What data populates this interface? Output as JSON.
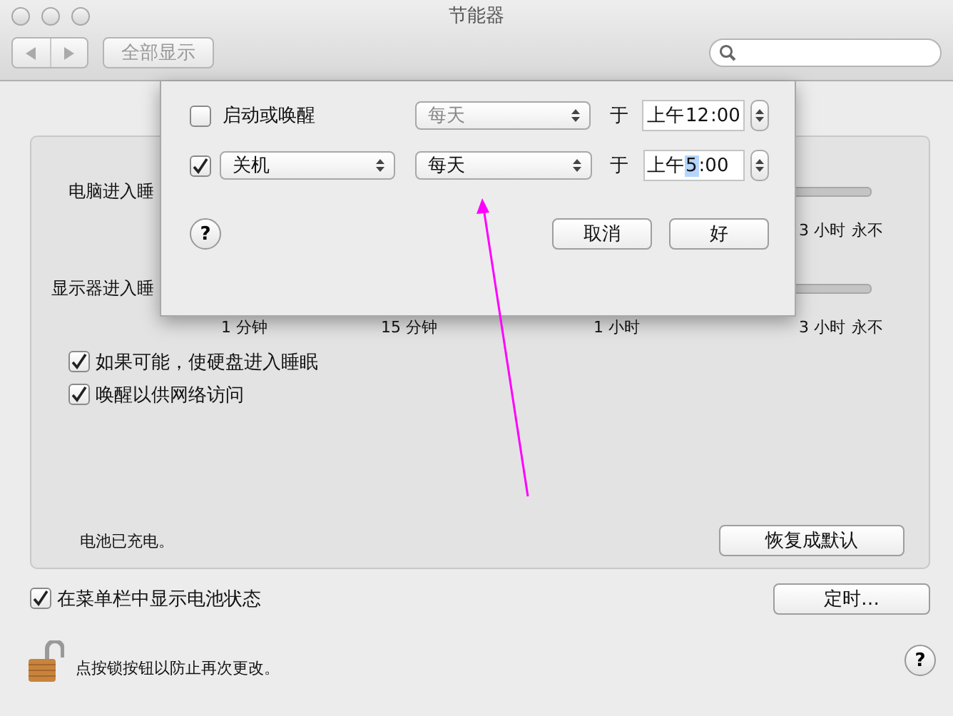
{
  "window": {
    "title": "节能器"
  },
  "toolbar": {
    "show_all": "全部显示"
  },
  "panel": {
    "sliders": [
      {
        "label": "电脑进入睡",
        "ticks": [
          "3 小时",
          "永不"
        ]
      },
      {
        "label": "显示器进入睡",
        "ticks": [
          "1 分钟",
          "15 分钟",
          "1 小时",
          "3 小时",
          "永不"
        ]
      }
    ],
    "options": [
      {
        "label": "如果可能，使硬盘进入睡眠",
        "checked": true
      },
      {
        "label": "唤醒以供网络访问",
        "checked": true
      }
    ],
    "battery_status": "电池已充电。",
    "restore_button": "恢复成默认"
  },
  "menu_bar_option": {
    "label": "在菜单栏中显示电池状态",
    "checked": true
  },
  "schedule_button": "定时…",
  "lock_text": "点按锁按钮以防止再次更改。",
  "help_button": "?",
  "sheet": {
    "rows": [
      {
        "checked": false,
        "event_label": "启动或唤醒",
        "day": "每天",
        "day_disabled": true,
        "at": "于",
        "time": {
          "prefix": "上午",
          "hour": "12",
          "rest": ":00",
          "hour_selected": false
        }
      },
      {
        "checked": true,
        "event_popup": "关机",
        "day": "每天",
        "day_disabled": false,
        "at": "于",
        "time": {
          "prefix": "上午",
          "hour": "5",
          "rest": ":00",
          "hour_selected": true
        }
      }
    ],
    "help_button": "?",
    "cancel": "取消",
    "ok": "好"
  }
}
